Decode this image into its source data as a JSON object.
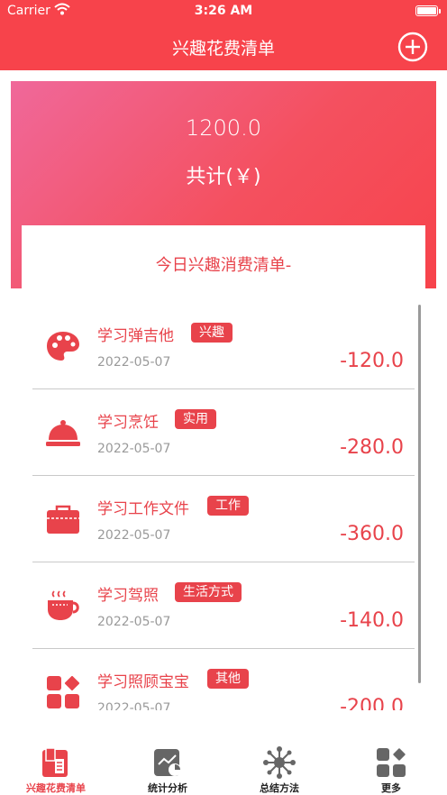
{
  "status_bar": {
    "carrier": "Carrier",
    "time": "3:26 AM"
  },
  "nav": {
    "title": "兴趣花费清单",
    "add_icon": "plus-circle-icon"
  },
  "summary": {
    "total_value": "1200.0",
    "total_label": "共计(￥)"
  },
  "today": {
    "title": "今日兴趣消费清单-"
  },
  "items": [
    {
      "title": "学习弹吉他",
      "tag": "兴趣",
      "date": "2022-05-07",
      "amount": "-120.0",
      "icon": "palette-icon"
    },
    {
      "title": "学习烹饪",
      "tag": "实用",
      "date": "2022-05-07",
      "amount": "-280.0",
      "icon": "cloche-icon"
    },
    {
      "title": "学习工作文件",
      "tag": "工作",
      "date": "2022-05-07",
      "amount": "-360.0",
      "icon": "briefcase-icon"
    },
    {
      "title": "学习驾照",
      "tag": "生活方式",
      "date": "2022-05-07",
      "amount": "-140.0",
      "icon": "coffee-cup-icon"
    },
    {
      "title": "学习照顾宝宝",
      "tag": "其他",
      "date": "2022-05-07",
      "amount": "-200.0",
      "icon": "grid-shapes-icon"
    }
  ],
  "tabs": [
    {
      "label": "兴趣花费清单",
      "icon": "book-icon",
      "active": true
    },
    {
      "label": "统计分析",
      "icon": "chart-icon",
      "active": false
    },
    {
      "label": "总结方法",
      "icon": "network-icon",
      "active": false
    },
    {
      "label": "更多",
      "icon": "grid-shapes-icon",
      "active": false
    }
  ],
  "colors": {
    "primary": "#f7434b",
    "gradient_start": "#f0689a",
    "text_accent": "#e8434b",
    "muted": "#9a9a9a"
  }
}
